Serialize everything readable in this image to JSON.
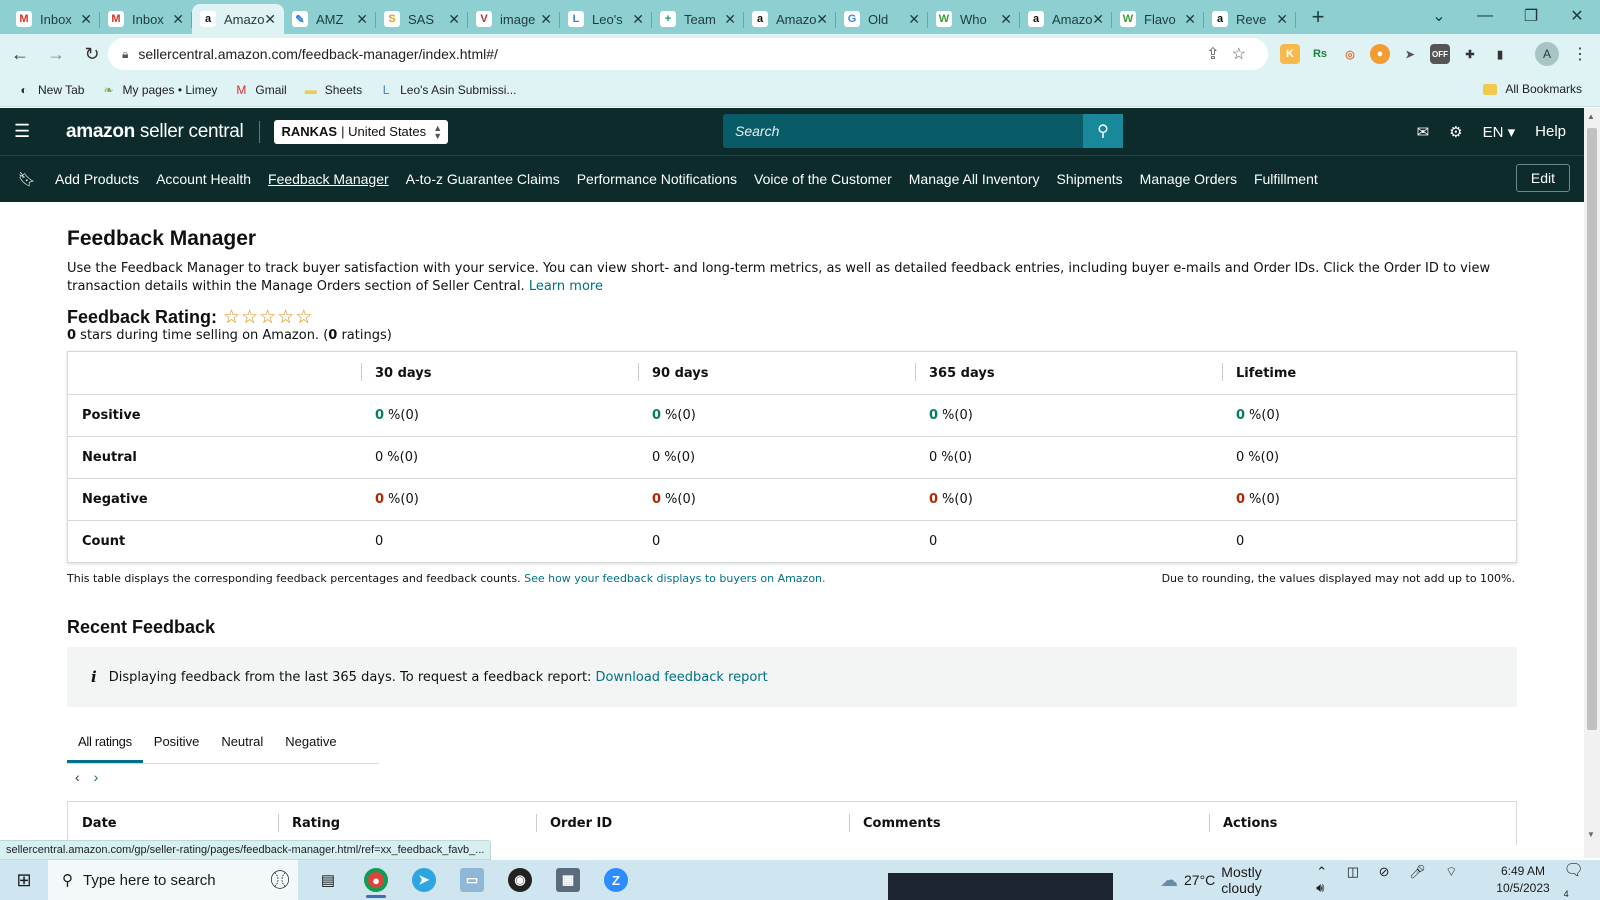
{
  "browser": {
    "tabs": [
      {
        "title": "Inbox",
        "icon": "gmail-icon",
        "color": "#d93025",
        "glyph": "M"
      },
      {
        "title": "Inbox",
        "icon": "gmail-icon",
        "color": "#d93025",
        "glyph": "M"
      },
      {
        "title": "Amazon",
        "icon": "amazon-icon",
        "color": "#111111",
        "glyph": "a",
        "active": true
      },
      {
        "title": "AMZ",
        "icon": "pencil-icon",
        "color": "#2f7bd6",
        "glyph": "✎"
      },
      {
        "title": "SAS",
        "icon": "sas-icon",
        "color": "#e79a2d",
        "glyph": "S"
      },
      {
        "title": "image",
        "icon": "v-logo-icon",
        "color": "#c0283b",
        "glyph": "V"
      },
      {
        "title": "Leo's",
        "icon": "leo-icon",
        "color": "#3f7fd0",
        "glyph": "L"
      },
      {
        "title": "Team",
        "icon": "sheets-plus-icon",
        "color": "#0f9d58",
        "glyph": "+"
      },
      {
        "title": "Amazon",
        "icon": "amazon-icon",
        "color": "#111111",
        "glyph": "a"
      },
      {
        "title": "Old",
        "icon": "google-icon",
        "color": "#4285f4",
        "glyph": "G"
      },
      {
        "title": "Who",
        "icon": "w-logo-icon",
        "color": "#3a9b3a",
        "glyph": "W"
      },
      {
        "title": "Amazon",
        "icon": "amazon-icon",
        "color": "#111111",
        "glyph": "a"
      },
      {
        "title": "Flavo",
        "icon": "w-logo-icon",
        "color": "#3a9b3a",
        "glyph": "W"
      },
      {
        "title": "Reve",
        "icon": "amazon-icon",
        "color": "#111111",
        "glyph": "a"
      }
    ],
    "url": "sellercentral.amazon.com/feedback-manager/index.html#/",
    "bookmarks": [
      {
        "label": "New Tab",
        "icon": "globe-icon"
      },
      {
        "label": "My pages • Limey",
        "icon": "limey-icon"
      },
      {
        "label": "Gmail",
        "icon": "gmail-icon"
      },
      {
        "label": "Sheets",
        "icon": "folder-icon"
      },
      {
        "label": "Leo's Asin Submissi...",
        "icon": "leo-icon"
      }
    ],
    "all_bookmarks": "All Bookmarks",
    "profile_initial": "A",
    "status_url": "sellercentral.amazon.com/gp/seller-rating/pages/feedback-manager.html/ref=xx_feedback_favb_..."
  },
  "header": {
    "logo_amazon": "amazon",
    "logo_sc": " seller central",
    "store": "RANKAS",
    "marketplace": "United States",
    "search_placeholder": "Search",
    "language": "EN",
    "help": "Help"
  },
  "nav": {
    "items": [
      "Add Products",
      "Account Health",
      "Feedback Manager",
      "A-to-z Guarantee Claims",
      "Performance Notifications",
      "Voice of the Customer",
      "Manage All Inventory",
      "Shipments",
      "Manage Orders",
      "Fulfillment"
    ],
    "current": "Feedback Manager",
    "edit": "Edit"
  },
  "page": {
    "title": "Feedback Manager",
    "description": "Use the Feedback Manager to track buyer satisfaction with your service. You can view short- and long-term metrics, as well as detailed feedback entries, including buyer e-mails and Order IDs. Click the Order ID to view transaction details within the Manage Orders section of Seller Central. ",
    "learn_more": "Learn more",
    "rating_label": "Feedback Rating:",
    "stars_filled": 0,
    "stars_total": 5,
    "stars_value": "0",
    "stars_text": " stars during time selling on Amazon. (",
    "ratings_count": "0",
    "ratings_text": " ratings)"
  },
  "feedback_table": {
    "columns": [
      "",
      "30 days",
      "90 days",
      "365 days",
      "Lifetime"
    ],
    "rows": [
      {
        "label": "Positive",
        "kind": "pos",
        "cells": [
          [
            "0",
            "%(0)"
          ],
          [
            "0",
            "%(0)"
          ],
          [
            "0",
            "%(0)"
          ],
          [
            "0",
            "%(0)"
          ]
        ]
      },
      {
        "label": "Neutral",
        "kind": "neu",
        "cells": [
          [
            "0",
            "%(0)"
          ],
          [
            "0",
            "%(0)"
          ],
          [
            "0",
            "%(0)"
          ],
          [
            "0",
            "%(0)"
          ]
        ]
      },
      {
        "label": "Negative",
        "kind": "neg",
        "cells": [
          [
            "0",
            "%(0)"
          ],
          [
            "0",
            "%(0)"
          ],
          [
            "0",
            "%(0)"
          ],
          [
            "0",
            "%(0)"
          ]
        ]
      },
      {
        "label": "Count",
        "kind": "count",
        "cells": [
          [
            "0",
            ""
          ],
          [
            "0",
            ""
          ],
          [
            "0",
            ""
          ],
          [
            "0",
            ""
          ]
        ]
      }
    ],
    "footer_left": "This table displays the corresponding feedback percentages and feedback counts. ",
    "footer_link": "See how your feedback displays to buyers on Amazon.",
    "footer_right": "Due to rounding, the values displayed may not add up to 100%."
  },
  "recent": {
    "title": "Recent Feedback",
    "info_text": "Displaying feedback from the last 365 days. To request a feedback report: ",
    "info_link": "Download feedback report",
    "tabs": [
      "All ratings",
      "Positive",
      "Neutral",
      "Negative"
    ],
    "selected_tab": "All ratings",
    "columns": [
      "Date",
      "Rating",
      "Order ID",
      "Comments",
      "Actions"
    ]
  },
  "taskbar": {
    "search_placeholder": "Type here to search",
    "weather_temp": "27°C",
    "weather_desc": "Mostly cloudy",
    "time": "6:49 AM",
    "date": "10/5/2023",
    "notification_count": "4"
  },
  "colors": {
    "header_bg": "#0d2b2b",
    "link": "#007185",
    "positive": "#067d62",
    "negative": "#b12704",
    "chrome_tabbar": "#8ed0d2"
  }
}
